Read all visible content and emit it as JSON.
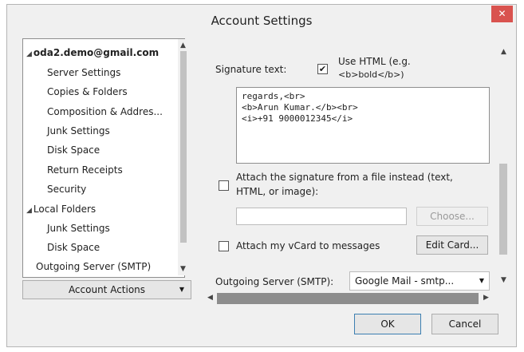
{
  "window": {
    "title": "Account Settings",
    "close_glyph": "✕"
  },
  "tree": {
    "items": [
      {
        "label": "oda2.demo@gmail.com",
        "level": 0,
        "expanded": true,
        "bold": true
      },
      {
        "label": "Server Settings",
        "level": 1
      },
      {
        "label": "Copies & Folders",
        "level": 1
      },
      {
        "label": "Composition & Addres...",
        "level": 1
      },
      {
        "label": "Junk Settings",
        "level": 1
      },
      {
        "label": "Disk Space",
        "level": 1
      },
      {
        "label": "Return Receipts",
        "level": 1
      },
      {
        "label": "Security",
        "level": 1
      },
      {
        "label": "Local Folders",
        "level": 0,
        "expanded": true
      },
      {
        "label": "Junk Settings",
        "level": 1
      },
      {
        "label": "Disk Space",
        "level": 1
      },
      {
        "label": "Outgoing Server (SMTP)",
        "level": 0
      }
    ]
  },
  "account_actions": {
    "label": "Account Actions",
    "arrow": "▼"
  },
  "signature": {
    "label": "Signature text:",
    "use_html_label": "Use HTML (e.g.",
    "use_html_label2": "<b>bold</b>)",
    "use_html_checked": true,
    "text_lines": [
      "regards,<br>",
      "<b>Arun Kumar.</b><br>",
      "<i>+91 9000012345</i>"
    ]
  },
  "attach_file": {
    "label": "Attach the signature from a file instead (text,",
    "label2": "HTML, or image):",
    "checked": false,
    "choose_label": "Choose...",
    "path_value": ""
  },
  "vcard": {
    "label": "Attach my vCard to messages",
    "checked": false,
    "edit_label": "Edit Card..."
  },
  "smtp": {
    "label": "Outgoing Server (SMTP):",
    "value": "Google Mail - smtp...",
    "arrow": "▼"
  },
  "buttons": {
    "ok": "OK",
    "cancel": "Cancel"
  },
  "icons": {
    "up": "▲",
    "down": "▼",
    "left": "◀",
    "right": "▶",
    "checkmark": "✔",
    "tri_open": "◢"
  }
}
